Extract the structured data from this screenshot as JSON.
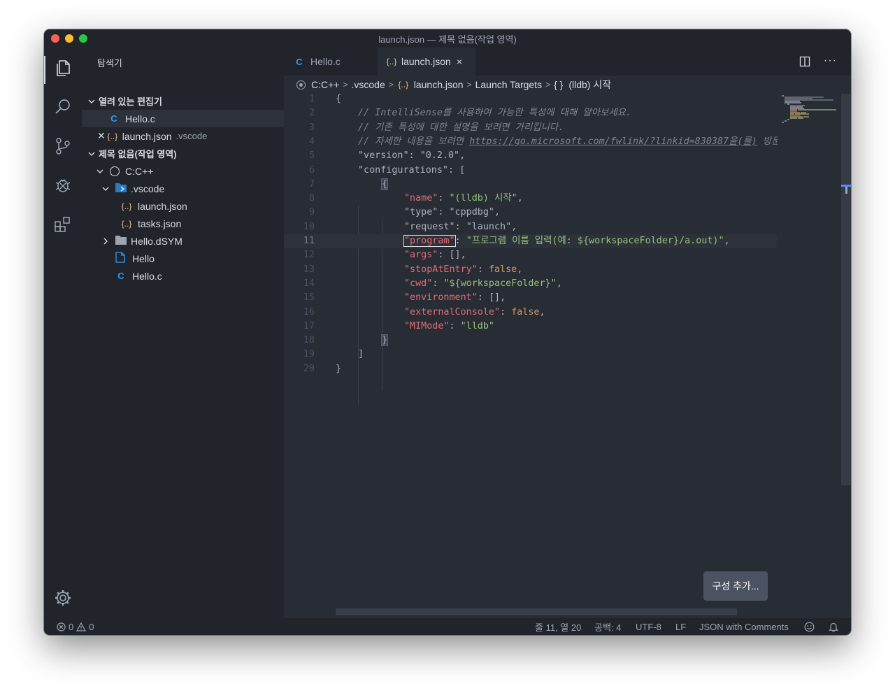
{
  "window": {
    "title": "launch.json — 제목 없음(작업 영역)"
  },
  "sidebar": {
    "title": "탐색기",
    "open_editors": {
      "label": "열려 있는 편집기",
      "items": [
        {
          "icon": "C",
          "name": "Hello.c",
          "folder": ""
        },
        {
          "icon": "{..}",
          "name": "launch.json",
          "folder": ".vscode"
        }
      ]
    },
    "workspace": {
      "label": "제목 없음(작업 영역)",
      "root": "C:C++",
      "items": [
        {
          "name": ".vscode"
        },
        {
          "icon": "{..}",
          "name": "launch.json"
        },
        {
          "icon": "{..}",
          "name": "tasks.json"
        },
        {
          "name": "Hello.dSYM"
        },
        {
          "name": "Hello"
        },
        {
          "icon": "C",
          "name": "Hello.c"
        }
      ]
    }
  },
  "tabs": [
    {
      "icon": "C",
      "label": "Hello.c"
    },
    {
      "icon": "{..}",
      "label": "launch.json",
      "close": "×"
    }
  ],
  "breadcrumb": [
    {
      "label": "C:C++"
    },
    {
      "label": ".vscode"
    },
    {
      "icon": "{..}",
      "label": "launch.json"
    },
    {
      "label": "Launch Targets"
    },
    {
      "icon": "{ }",
      "label": "(lldb) 시작"
    }
  ],
  "code": {
    "current_line": 11,
    "line_numbers": [
      "1",
      "2",
      "3",
      "4",
      "5",
      "6",
      "7",
      "8",
      "9",
      "10",
      "11",
      "12",
      "13",
      "14",
      "15",
      "16",
      "17",
      "18",
      "19",
      "20"
    ],
    "lines": {
      "l1": "{",
      "l2": "// IntelliSense를 사용하여 가능한 특성에 대해 알아보세요.",
      "l3": "// 기존 특성에 대한 설명을 보려면 가리킵니다.",
      "l4a": "// 자세한 내용을 보려면 ",
      "l4url": "https://go.microsoft.com/fwlink/?linkid=830387을(를)",
      "l4b": " 방문",
      "l5k": "\"version\"",
      "l5v": "\"0.2.0\"",
      "l6k": "\"configurations\"",
      "l6v": "[",
      "l7": "{",
      "l8k": "\"name\"",
      "l8v": "\"(lldb) 시작\"",
      "l9k": "\"type\"",
      "l9v": "\"cppdbg\"",
      "l10k": "\"request\"",
      "l10v": "\"launch\"",
      "l11k": "\"program\"",
      "l11v": "\"프로그램 이름 입력(예: ${workspaceFolder}/a.out)\"",
      "l12k": "\"args\"",
      "l12v": "[]",
      "l13k": "\"stopAtEntry\"",
      "l13v": "false",
      "l14k": "\"cwd\"",
      "l14v": "\"${workspaceFolder}\"",
      "l15k": "\"environment\"",
      "l15v": "[]",
      "l16k": "\"externalConsole\"",
      "l16v": "false",
      "l17k": "\"MIMode\"",
      "l17v": "\"lldb\"",
      "l18": "}",
      "l19": "]",
      "l20": "}"
    }
  },
  "add_config_button": "구성 추가...",
  "status": {
    "errors": "0",
    "warnings": "0",
    "position": "줄 11, 열 20",
    "spaces": "공백: 4",
    "encoding": "UTF-8",
    "eol": "LF",
    "language": "JSON with Comments"
  },
  "colors": {
    "bg": "#282c34",
    "sidebar_bg": "#21252b",
    "key": "#e06c75",
    "string": "#98c379",
    "boolean": "#d19a66",
    "comment": "#7f848e",
    "c_icon": "#2c9cf5",
    "json_icon": "#e5c07b"
  }
}
